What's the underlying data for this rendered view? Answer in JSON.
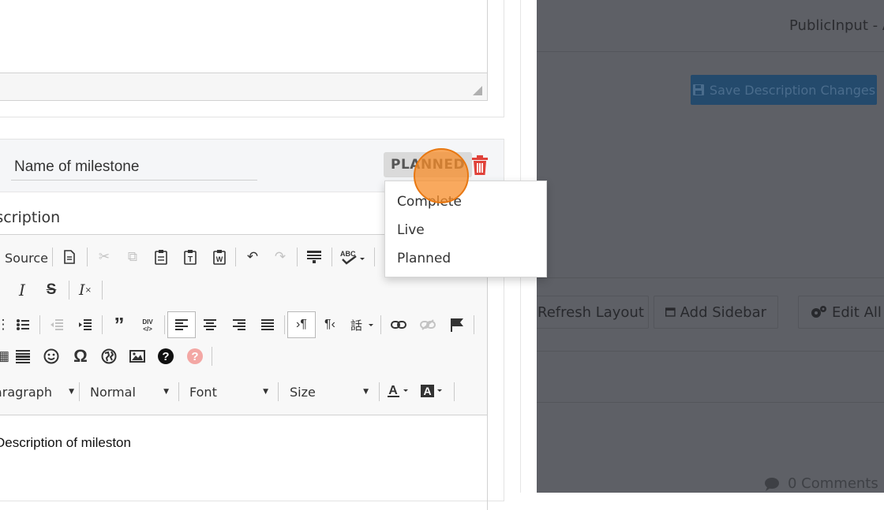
{
  "background": {
    "title": "PublicInput - A",
    "save_button": "Save Description Changes",
    "refresh_layout": "Refresh Layout",
    "add_sidebar": "Add Sidebar",
    "edit_all": "Edit All",
    "comments": "0 Comments"
  },
  "milestone": {
    "name_value": "Name of milestone",
    "status": "PLANNED",
    "description_label": "Description",
    "description_content": "Description of mileston"
  },
  "toolbar": {
    "source_label": "Source",
    "format_value": "Paragraph",
    "style_value": "Normal",
    "font_value": "Font",
    "size_value": "Size"
  },
  "status_menu": {
    "options": [
      "Complete",
      "Live",
      "Planned"
    ]
  },
  "colors": {
    "dim_overlay": "#5e6066",
    "trash": "#e0423a",
    "click_marker": "#f78c28"
  }
}
